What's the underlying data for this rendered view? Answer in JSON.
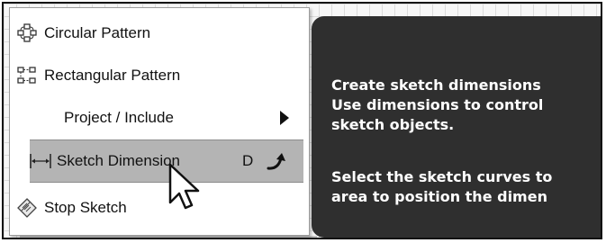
{
  "menu": {
    "items": [
      {
        "label": "Circular Pattern",
        "icon": "circular-pattern-icon"
      },
      {
        "label": "Rectangular Pattern",
        "icon": "rectangular-pattern-icon"
      },
      {
        "label": "Project / Include",
        "icon": "submenu-arrow-icon"
      },
      {
        "label": "Sketch Dimension",
        "icon": "sketch-dimension-icon",
        "shortcut": "D",
        "extra_icon": "repeat-arrow-icon",
        "highlighted": true
      },
      {
        "label": "Stop Sketch",
        "icon": "stop-sketch-icon"
      }
    ]
  },
  "tooltip": {
    "lines": [
      "Create sketch dimensions",
      "Use dimensions to control",
      "sketch objects.",
      "Select the sketch curves to",
      "area to position the dimen"
    ]
  },
  "colors": {
    "highlight": "#b4b4b4",
    "tooltip_bg": "#2f2f2f",
    "tooltip_text": "#ffffff"
  }
}
